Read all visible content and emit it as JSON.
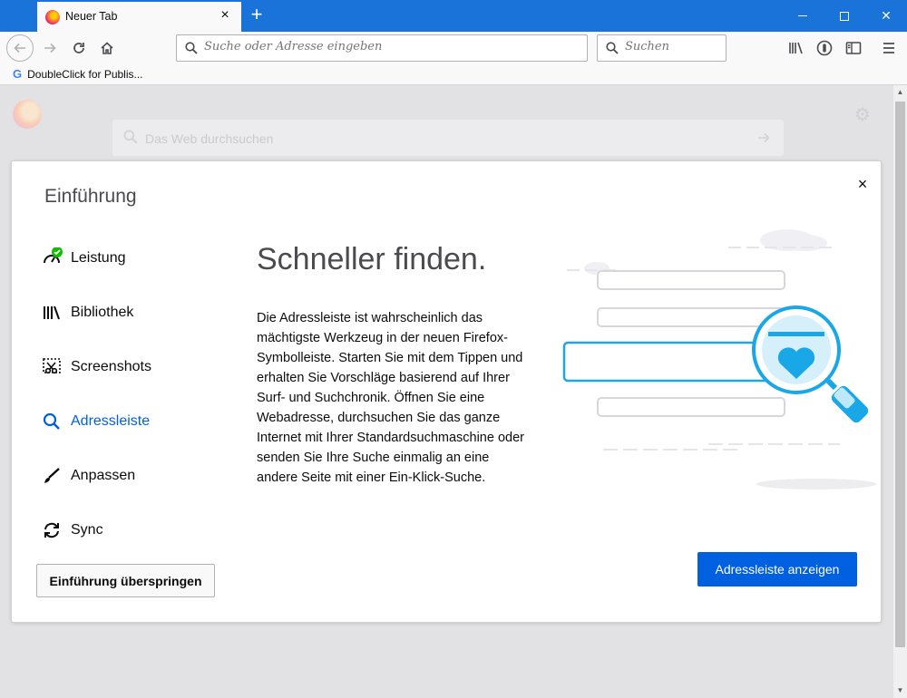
{
  "browser": {
    "tab_title": "Neuer Tab",
    "tab_close": "×",
    "new_tab": "+",
    "window_close": "✕"
  },
  "navbar": {
    "url_placeholder": "Suche oder Adresse eingeben",
    "search_placeholder": "Suchen"
  },
  "bookmarks": {
    "items": [
      {
        "icon": "google-icon",
        "label": "DoubleClick for Publis..."
      }
    ]
  },
  "background": {
    "search_placeholder": "Das Web durchsuchen"
  },
  "onboarding": {
    "title": "Einführung",
    "close": "×",
    "nav": [
      {
        "label": "Leistung",
        "icon": "gauge-icon",
        "completed": true
      },
      {
        "label": "Bibliothek",
        "icon": "library-icon"
      },
      {
        "label": "Screenshots",
        "icon": "screenshot-icon"
      },
      {
        "label": "Adressleiste",
        "icon": "search-icon",
        "active": true
      },
      {
        "label": "Anpassen",
        "icon": "brush-icon"
      },
      {
        "label": "Sync",
        "icon": "sync-icon"
      }
    ],
    "headline": "Schneller finden.",
    "description": "Die Adressleiste ist wahrscheinlich das mächtigste Werkzeug in der neuen Firefox-Symbolleiste. Starten Sie mit dem Tippen und erhalten Sie Vorschläge basierend auf Ihrer Surf- und Suchchronik. Öffnen Sie eine Webadresse, durchsuchen Sie das ganze Internet mit Ihrer Standardsuchmaschine oder senden Sie Ihre Suche einmalig an eine andere Seite mit einer Ein-Klick-Suche.",
    "skip_button": "Einführung überspringen",
    "action_button": "Adressleiste anzeigen"
  },
  "colors": {
    "titlebar": "#1a73d9",
    "accent": "#0060df",
    "illustration_blue": "#1aa7e8",
    "check_green": "#12bc00"
  }
}
